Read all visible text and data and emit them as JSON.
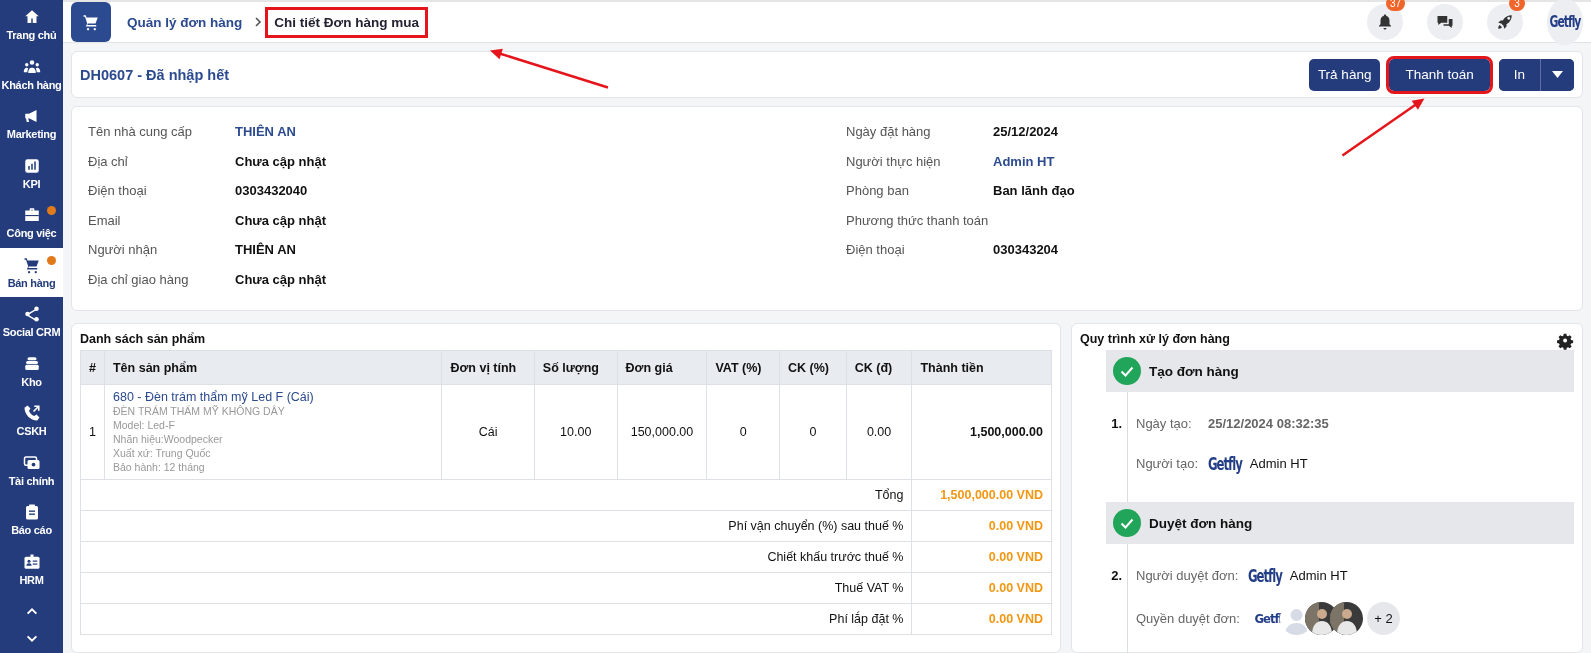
{
  "sidebar": {
    "items": [
      {
        "label": "Trang chủ",
        "selected": false,
        "dot": false
      },
      {
        "label": "Khách hàng",
        "selected": false,
        "dot": false
      },
      {
        "label": "Marketing",
        "selected": false,
        "dot": false
      },
      {
        "label": "KPI",
        "selected": false,
        "dot": false
      },
      {
        "label": "Công việc",
        "selected": false,
        "dot": true
      },
      {
        "label": "Bán hàng",
        "selected": true,
        "dot": true
      },
      {
        "label": "Social CRM",
        "selected": false,
        "dot": false
      },
      {
        "label": "Kho",
        "selected": false,
        "dot": false
      },
      {
        "label": "CSKH",
        "selected": false,
        "dot": false
      },
      {
        "label": "Tài chính",
        "selected": false,
        "dot": false
      },
      {
        "label": "Báo cáo",
        "selected": false,
        "dot": false
      },
      {
        "label": "HRM",
        "selected": false,
        "dot": false
      }
    ]
  },
  "header": {
    "breadcrumb": [
      {
        "label": "Quản lý đơn hàng",
        "highlighted": false
      },
      {
        "label": "Chi tiết Đơn hàng mua",
        "highlighted": true
      }
    ],
    "notification_badge": "37",
    "rocket_badge": "3",
    "avatar_logo": "Getfly"
  },
  "order": {
    "title": "DH0607 - Đã nhập hết",
    "buttons": [
      {
        "label": "Trả hàng",
        "kind": "plain",
        "highlighted": false
      },
      {
        "label": "Thanh toán",
        "kind": "plain",
        "highlighted": true
      },
      {
        "label": "In",
        "kind": "split",
        "highlighted": false
      }
    ]
  },
  "details": {
    "left": [
      {
        "label": "Tên nhà cung cấp",
        "value": "THIÊN AN",
        "link": true
      },
      {
        "label": "Địa chỉ",
        "value": "Chưa cập nhật",
        "link": false
      },
      {
        "label": "Điện thoại",
        "value": "0303432040",
        "link": false
      },
      {
        "label": "Email",
        "value": "Chưa cập nhật",
        "link": false
      },
      {
        "label": "Người nhận",
        "value": "THIÊN AN",
        "link": false
      },
      {
        "label": "Địa chỉ giao hàng",
        "value": "Chưa cập nhật",
        "link": false
      }
    ],
    "right": [
      {
        "label": "Ngày đặt hàng",
        "value": "25/12/2024",
        "link": false
      },
      {
        "label": "Người thực hiện",
        "value": "Admin HT",
        "link": true
      },
      {
        "label": "Phòng ban",
        "value": "Ban lãnh đạo",
        "link": false
      },
      {
        "label": "Phương thức thanh toán"
      },
      {
        "label": "Điện thoại",
        "value": "030343204",
        "link": false
      }
    ]
  },
  "products": {
    "title": "Danh sách sản phẩm",
    "columns": [
      "#",
      "Tên sản phẩm",
      "Đơn vị tính",
      "Số lượng",
      "Đơn giá",
      "VAT (%)",
      "CK (%)",
      "CK (đ)",
      "Thành tiền"
    ],
    "rows": [
      {
        "index": "1",
        "name": "680 - Đèn trám thẩm mỹ Led F (Cái)",
        "details": [
          "ĐÈN TRÁM THẨM MỸ KHÔNG DÂY",
          "Model: Led-F",
          "Nhãn hiệu:Woodpecker",
          "Xuất xứ: Trung Quốc",
          "Bảo hành: 12 tháng"
        ],
        "unit": "Cái",
        "quantity": "10.00",
        "price": "150,000.00",
        "vat": "0",
        "ck_percent": "0",
        "ck_amount": "0.00",
        "total": "1,500,000.00"
      }
    ],
    "summary": [
      {
        "label": "Tổng",
        "value": "1,500,000.00 VND"
      },
      {
        "label": "Phí vận chuyển (%) sau thuế %",
        "value": "0.00 VND"
      },
      {
        "label": "Chiết khấu trước thuế %",
        "value": "0.00 VND"
      },
      {
        "label": "Thuế VAT %",
        "value": "0.00 VND"
      },
      {
        "label": "Phí lắp đặt %",
        "value": "0.00 VND"
      }
    ]
  },
  "workflow": {
    "title": "Quy trình xử lý đơn hàng",
    "steps": [
      {
        "title": "Tạo đơn hàng",
        "done": true,
        "number": "1.",
        "fields": [
          {
            "label": "Ngày tạo:",
            "kind": "text",
            "value": "25/12/2024 08:32:35"
          },
          {
            "label": "Người tạo:",
            "kind": "user",
            "logo": "Getfly",
            "value": "Admin HT"
          }
        ]
      },
      {
        "title": "Duyệt đơn hàng",
        "done": true,
        "number": "2.",
        "fields": [
          {
            "label": "Người duyệt đơn:",
            "kind": "user",
            "logo": "Getfly",
            "value": "Admin HT"
          },
          {
            "label": "Quyền duyệt đơn:",
            "kind": "avatars",
            "avatars": [
              {
                "kind": "logo",
                "logo": "Getfl"
              },
              {
                "kind": "silhouette"
              },
              {
                "kind": "photo"
              },
              {
                "kind": "photo"
              }
            ],
            "more": "+ 2"
          }
        ]
      }
    ]
  }
}
